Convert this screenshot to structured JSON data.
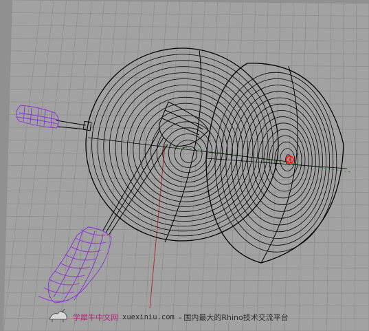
{
  "viewport": {
    "name": "perspective-viewport",
    "colors": {
      "background": "#909090",
      "grid_plane": "#a3a3a3",
      "grid_line": "#8c8c8c",
      "x_axis": "#b03030",
      "y_axis": "#2e8b2e",
      "wireframe": "#000000",
      "selected": "#8a2be2",
      "cursor": "#ff2020"
    }
  },
  "watermark": {
    "brand": "学犀牛中文网",
    "url": "xuexiniu.com",
    "slogan": "- 国内最大的Rhino技术交流平台",
    "brand_color": "#b02a7a"
  }
}
